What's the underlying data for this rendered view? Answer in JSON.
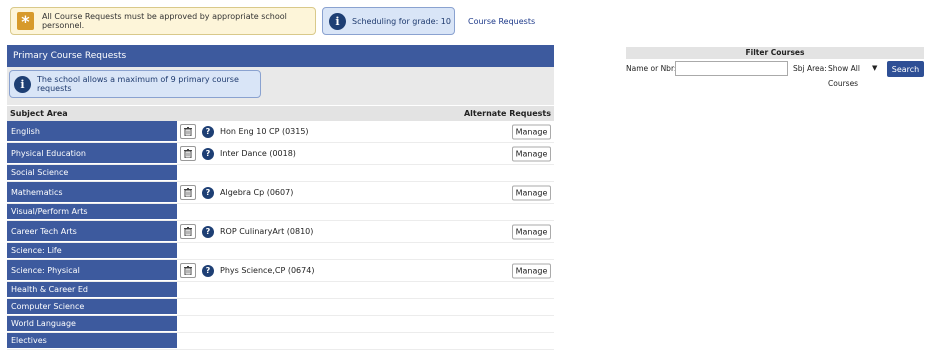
{
  "banners": {
    "approval_text": "All Course Requests must be approved by appropriate school personnel.",
    "scheduling_text": "Scheduling for grade: 10",
    "course_requests_link": "Course Requests"
  },
  "panel": {
    "title": "Primary Course Requests",
    "max_notice": "The school allows a maximum of 9 primary course requests",
    "subject_area_header": "Subject Area",
    "alternate_header": "Alternate Requests"
  },
  "rows": [
    {
      "subject": "English",
      "course": "Hon Eng 10 CP (0315)",
      "manage": "Manage"
    },
    {
      "subject": "Physical Education",
      "course": "Inter Dance (0018)",
      "manage": "Manage"
    },
    {
      "subject": "Social Science",
      "course": "",
      "manage": ""
    },
    {
      "subject": "Mathematics",
      "course": "Algebra Cp (0607)",
      "manage": "Manage"
    },
    {
      "subject": "Visual/Perform Arts",
      "course": "",
      "manage": ""
    },
    {
      "subject": "Career Tech Arts",
      "course": "ROP CulinaryArt (0810)",
      "manage": "Manage"
    },
    {
      "subject": "Science: Life",
      "course": "",
      "manage": ""
    },
    {
      "subject": "Science: Physical",
      "course": "Phys Science,CP (0674)",
      "manage": "Manage"
    },
    {
      "subject": "Health & Career Ed",
      "course": "",
      "manage": ""
    },
    {
      "subject": "Computer Science",
      "course": "",
      "manage": ""
    },
    {
      "subject": "World Language",
      "course": "",
      "manage": ""
    },
    {
      "subject": "Electives",
      "course": "",
      "manage": ""
    }
  ],
  "filter": {
    "title": "Filter Courses",
    "name_label": "Name or Nbr:",
    "name_value": "",
    "subject_label": "Sbj Area:",
    "subject_selected": "Show All Courses",
    "search_label": "Search"
  },
  "colors": {
    "primary_navy": "#3d5a9e",
    "info_bg": "#d9e5f7",
    "warn_bg": "#fdf5d9",
    "star_orange": "#d79a2b"
  }
}
